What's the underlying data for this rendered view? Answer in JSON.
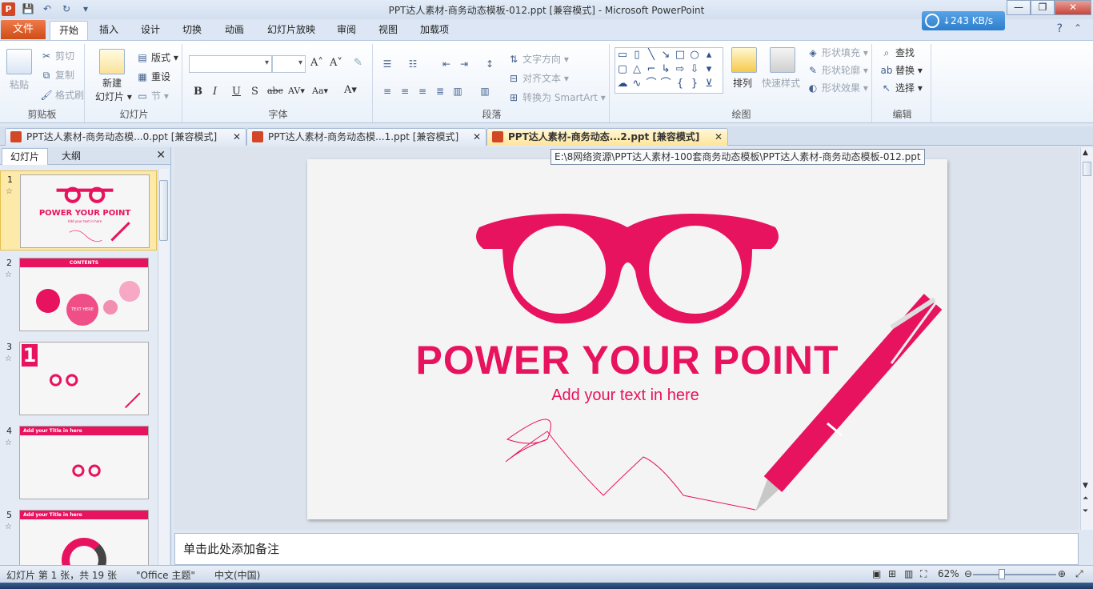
{
  "window": {
    "title": "PPT达人素材-商务动态模板-012.ppt [兼容模式]  -  Microsoft PowerPoint",
    "app_icon": "P",
    "controls": [
      "—",
      "❐",
      "✕"
    ]
  },
  "netspeed": "↓243 KB/s",
  "ribbon": {
    "tabs": [
      "文件",
      "开始",
      "插入",
      "设计",
      "切换",
      "动画",
      "幻灯片放映",
      "审阅",
      "视图",
      "加载项"
    ],
    "active_tab": "开始",
    "clipboard": {
      "label": "剪贴板",
      "paste": "粘贴",
      "cut": "剪切",
      "copy": "复制",
      "format": "格式刷"
    },
    "slides": {
      "label": "幻灯片",
      "new_slide": "新建",
      "new_slide2": "幻灯片 ▾",
      "layout": "版式 ▾",
      "reset": "重设",
      "section": "节 ▾"
    },
    "font": {
      "label": "字体",
      "bold": "B",
      "italic": "I",
      "underline": "U",
      "shadow": "S",
      "strike": "abc",
      "spacing": "AV▾",
      "case": "Aa▾",
      "color": "A▾",
      "grow": "A˄",
      "shrink": "A˅"
    },
    "paragraph": {
      "label": "段落",
      "text_dir": "文字方向 ▾",
      "align_text": "对齐文本 ▾",
      "smartart": "转换为 SmartArt ▾"
    },
    "drawing": {
      "label": "绘图",
      "arrange": "排列",
      "quick_styles": "快速样式",
      "fill": "形状填充 ▾",
      "outline": "形状轮廓 ▾",
      "effects": "形状效果 ▾"
    },
    "editing": {
      "label": "编辑",
      "find": "查找",
      "replace": "替换 ▾",
      "select": "选择 ▾"
    }
  },
  "doc_tabs": [
    {
      "label": "PPT达人素材-商务动态模...0.ppt [兼容模式]",
      "active": false
    },
    {
      "label": "PPT达人素材-商务动态模...1.ppt [兼容模式]",
      "active": false
    },
    {
      "label": "PPT达人素材-商务动态...2.ppt [兼容模式]",
      "active": true
    }
  ],
  "tooltip": "E:\\8网络资源\\PPT达人素材-100套商务动态模板\\PPT达人素材-商务动态模板-012.ppt",
  "left_pane": {
    "tabs": [
      "幻灯片",
      "大纲"
    ],
    "slides": [
      {
        "num": "1",
        "title": "POWER YOUR POINT",
        "sub": "Add your text in here"
      },
      {
        "num": "2",
        "title": "CONTENTS",
        "sub": "TEXT HERE"
      },
      {
        "num": "3",
        "title": "1",
        "sub": ""
      },
      {
        "num": "4",
        "title": "Add your Title in here",
        "sub": ""
      },
      {
        "num": "5",
        "title": "Add your Title in here",
        "sub": ""
      }
    ]
  },
  "slide": {
    "title": "POWER YOUR POINT",
    "subtitle": "Add your text in here"
  },
  "notes_placeholder": "单击此处添加备注",
  "status": {
    "slide_info": "幻灯片 第 1 张，共 19 张",
    "theme": "\"Office 主题\"",
    "lang": "中文(中国)",
    "zoom": "62%"
  },
  "colors": {
    "accent": "#e8135e",
    "file_tab": "#d04c17"
  }
}
